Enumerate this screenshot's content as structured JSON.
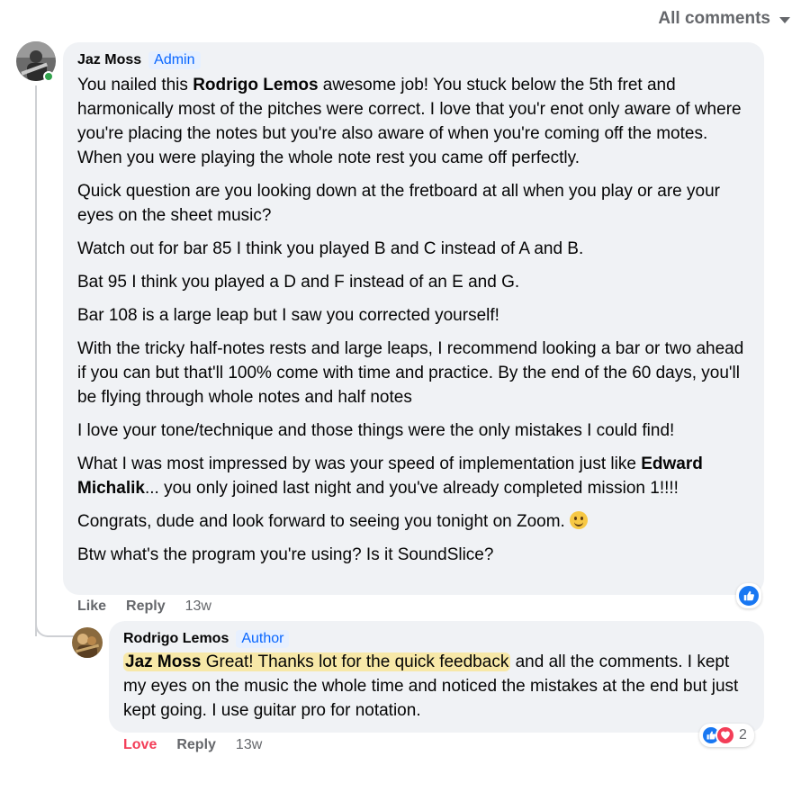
{
  "filter": {
    "label": "All comments",
    "icon": "caret-down-icon"
  },
  "comment": {
    "author": "Jaz Moss",
    "badge": "Admin",
    "paragraph_1": {
      "mention": "Rodrigo Lemos",
      "before": "You nailed this ",
      "after": " awesome job! You stuck below the 5th fret and harmonically most of the pitches were correct. I love that you'r enot only aware of where you're placing the notes but you're also aware of when you're coming off the motes. When you were playing the whole note rest you came off perfectly."
    },
    "paragraph_2": "Quick question are you looking down at the fretboard at all when you play or are your eyes on the sheet music?",
    "paragraph_3": "Watch out for bar 85 I think you played B and C instead of A and B.",
    "paragraph_4": "Bat 95 I think you played a D and F instead of an E and G.",
    "paragraph_5": "Bar 108 is a large leap but I saw you corrected yourself!",
    "paragraph_6": "With the tricky half-notes rests and large leaps, I recommend looking a bar or two ahead if you can but that'll 100% come with time and practice. By the end of the 60 days, you'll be flying through whole notes and half notes",
    "paragraph_7": "I love your tone/technique and those things were the only mistakes I could find!",
    "paragraph_8": {
      "before": "What I was most impressed by was your speed of implementation just like ",
      "mention": "Edward Michalik",
      "after": "... you only joined last night and you've already completed mission 1!!!!"
    },
    "paragraph_9": "Congrats, dude and look forward to seeing you tonight on Zoom. ",
    "paragraph_10": "Btw what's the program you're using? Is it SoundSlice?",
    "actions": {
      "like": "Like",
      "reply": "Reply",
      "time": "13w"
    },
    "reactions": {
      "types": [
        "like"
      ]
    }
  },
  "reply": {
    "author": "Rodrigo Lemos",
    "badge": "Author",
    "mention": "Jaz Moss",
    "highlighted_text": " Great! Thanks lot for the quick feedback",
    "rest_text": " and all the comments. I kept my eyes on the music the whole time and noticed the mistakes at the end but just kept going. I use guitar pro for notation.",
    "actions": {
      "love": "Love",
      "reply": "Reply",
      "time": "13w"
    },
    "reactions": {
      "types": [
        "like",
        "love"
      ],
      "count": "2"
    }
  },
  "colors": {
    "accent": "#0866ff",
    "love": "#f33e58",
    "bubble": "#f0f2f5",
    "muted": "#65676b"
  }
}
